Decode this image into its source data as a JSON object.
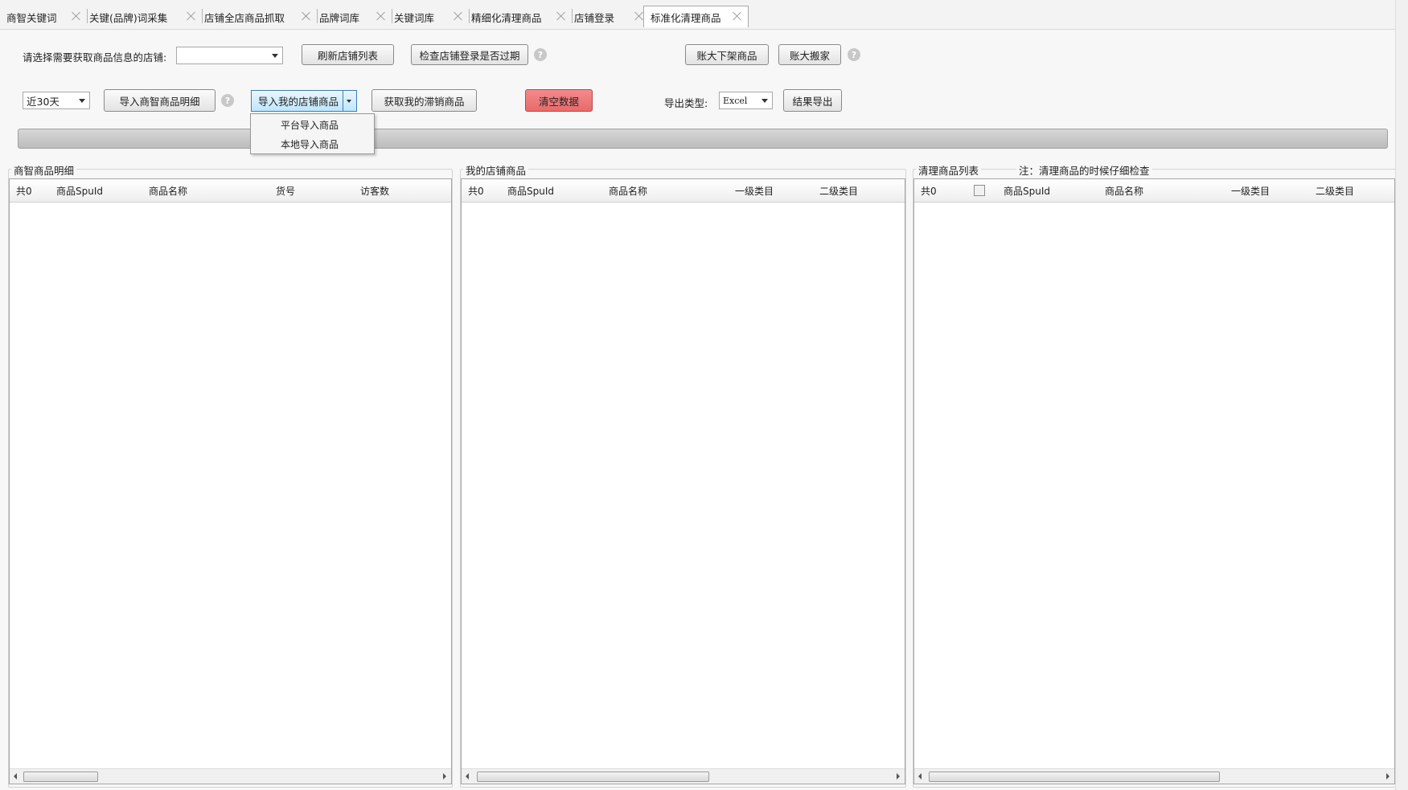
{
  "tabs": [
    {
      "label": "商智关键词"
    },
    {
      "label": "关键(品牌)词采集"
    },
    {
      "label": "店铺全店商品抓取"
    },
    {
      "label": "品牌词库"
    },
    {
      "label": "关键词库"
    },
    {
      "label": "精细化清理商品"
    },
    {
      "label": "店铺登录"
    },
    {
      "label": "标准化清理商品"
    }
  ],
  "row1": {
    "store_label": "请选择需要获取商品信息的店铺:",
    "store_value": "",
    "refresh_btn": "刷新店铺列表",
    "check_login_btn": "检查店铺登录是否过期",
    "help": "?",
    "delist_btn": "账大下架商品",
    "move_btn": "账大搬家",
    "help2": "?"
  },
  "row2": {
    "period_value": "近30天",
    "import_detail_btn": "导入商智商品明细",
    "help": "?",
    "import_my_btn": "导入我的店铺商品",
    "get_unsold_btn": "获取我的滞销商品",
    "clear_btn": "清空数据",
    "export_type_label": "导出类型:",
    "export_type_value": "Excel",
    "export_btn": "结果导出"
  },
  "dropdown_menu": {
    "items": [
      "平台导入商品",
      "本地导入商品"
    ]
  },
  "colors": {
    "clear_btn": "#ee7a7a",
    "split_btn": "#bee6fd"
  },
  "panels": {
    "left": {
      "title": "商智商品明细",
      "columns": [
        "共0",
        "商品SpuId",
        "商品名称",
        "货号",
        "访客数"
      ]
    },
    "middle": {
      "title": "我的店铺商品",
      "columns": [
        "共0",
        "商品SpuId",
        "商品名称",
        "一级类目",
        "二级类目"
      ]
    },
    "right": {
      "title": "清理商品列表",
      "note": "注：清理商品的时候仔细检查",
      "columns": [
        "共0",
        "商品SpuId",
        "商品名称",
        "一级类目",
        "二级类目"
      ]
    }
  }
}
